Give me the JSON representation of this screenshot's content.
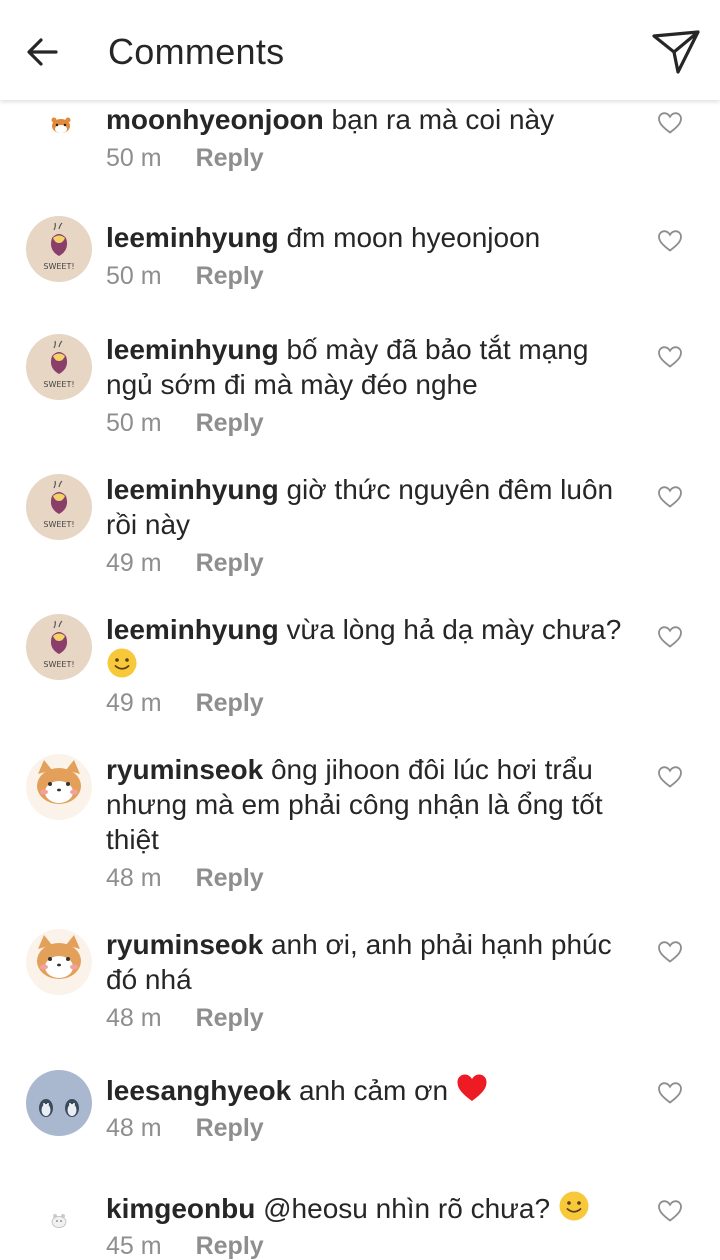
{
  "header": {
    "title": "Comments"
  },
  "comments": [
    {
      "username": "moonhyeonjoon",
      "text": "bạn ra mà coi này",
      "emoji": "",
      "time": "50 m",
      "reply": "Reply",
      "avatar": "hamster-avatar"
    },
    {
      "username": "leeminhyung",
      "text": "đm moon hyeonjoon",
      "emoji": "",
      "time": "50 m",
      "reply": "Reply",
      "avatar": "sweet-potato-avatar"
    },
    {
      "username": "leeminhyung",
      "text": "bố mày đã bảo tắt mạng ngủ sớm đi mà mày đéo nghe",
      "emoji": "",
      "time": "50 m",
      "reply": "Reply",
      "avatar": "sweet-potato-avatar"
    },
    {
      "username": "leeminhyung",
      "text": "giờ thức nguyên đêm luôn rồi này",
      "emoji": "",
      "time": "49 m",
      "reply": "Reply",
      "avatar": "sweet-potato-avatar"
    },
    {
      "username": "leeminhyung",
      "text": "vừa lòng hả dạ mày chưa?",
      "emoji": "slightly-smiling-face",
      "time": "49 m",
      "reply": "Reply",
      "avatar": "sweet-potato-avatar"
    },
    {
      "username": "ryuminseok",
      "text": "ông jihoon đôi lúc hơi trẩu nhưng mà em phải công nhận là ổng tốt thiệt",
      "emoji": "",
      "time": "48 m",
      "reply": "Reply",
      "avatar": "shiba-avatar"
    },
    {
      "username": "ryuminseok",
      "text": "anh ơi, anh phải hạnh phúc đó nhá",
      "emoji": "",
      "time": "48 m",
      "reply": "Reply",
      "avatar": "shiba-avatar"
    },
    {
      "username": "leesanghyeok",
      "text": "anh cảm ơn",
      "emoji": "red-heart",
      "time": "48 m",
      "reply": "Reply",
      "avatar": "penguins-avatar"
    },
    {
      "username": "kimgeonbu",
      "text": "@heosu nhìn rõ chưa?",
      "emoji": "slightly-smiling-face",
      "time": "45 m",
      "reply": "Reply",
      "avatar": "bear-avatar"
    }
  ],
  "colors": {
    "text": "#262626",
    "meta": "#8e8e8e",
    "heart": "#ed1c24",
    "emoji": "#f7c83a"
  }
}
